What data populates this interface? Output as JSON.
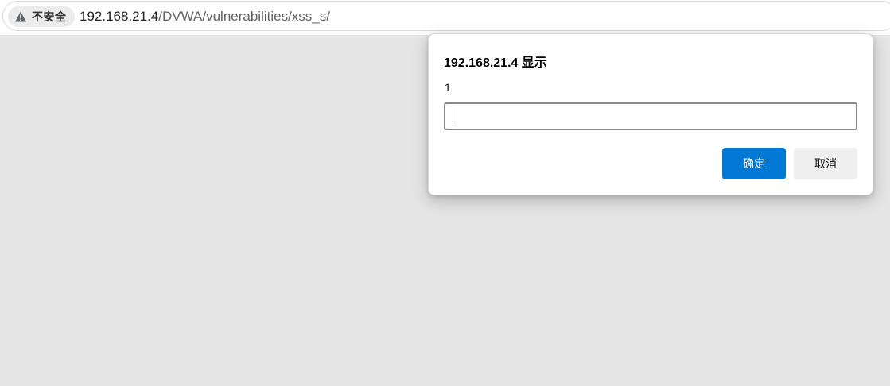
{
  "address_bar": {
    "security_label": "不安全",
    "security_icon": "warning-triangle-icon",
    "url_host": "192.168.21.4",
    "url_path": "/DVWA/vulnerabilities/xss_s/"
  },
  "prompt_dialog": {
    "title": "192.168.21.4 显示",
    "message": "1",
    "input_value": "",
    "ok_label": "确定",
    "cancel_label": "取消",
    "accent_color": "#0078d4"
  }
}
